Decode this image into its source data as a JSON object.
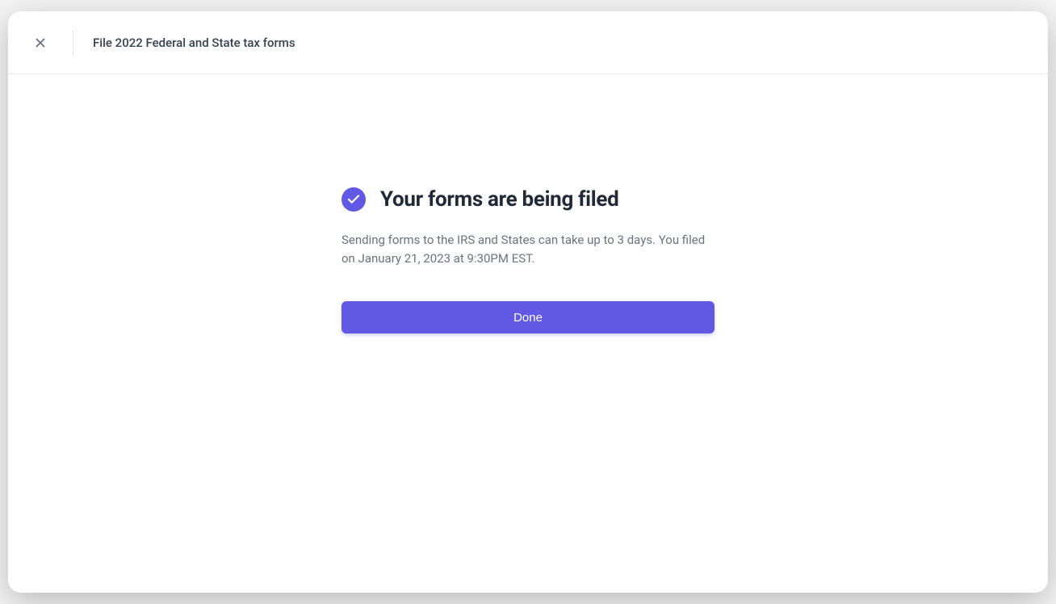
{
  "header": {
    "title": "File 2022 Federal and State tax forms"
  },
  "main": {
    "heading": "Your forms are being filed",
    "description": "Sending forms to the IRS and States can take up to 3 days. You filed on January 21, 2023 at 9:30PM EST.",
    "done_label": "Done"
  }
}
